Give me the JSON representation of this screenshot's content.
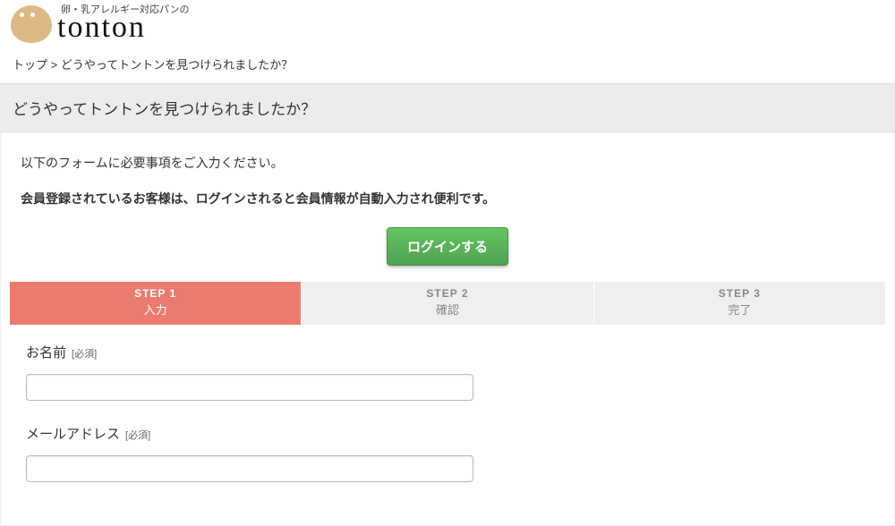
{
  "logo": {
    "tagline": "卵・乳アレルギー対応パンの",
    "name": "tonton"
  },
  "breadcrumb": {
    "top": "トップ",
    "sep": ">",
    "current": "どうやってトントンを見つけられましたか？"
  },
  "page_title": "どうやってトントンを見つけられましたか？",
  "intro": "以下のフォームに必要事項をご入力ください。",
  "intro_bold": "会員登録されているお客様は、ログインされると会員情報が自動入力され便利です。",
  "login_button": "ログインする",
  "steps": [
    {
      "label": "STEP 1",
      "sub": "入力"
    },
    {
      "label": "STEP 2",
      "sub": "確認"
    },
    {
      "label": "STEP 3",
      "sub": "完了"
    }
  ],
  "fields": {
    "name": {
      "label": "お名前",
      "required": "[必須]"
    },
    "email": {
      "label": "メールアドレス",
      "required": "[必須]"
    }
  }
}
